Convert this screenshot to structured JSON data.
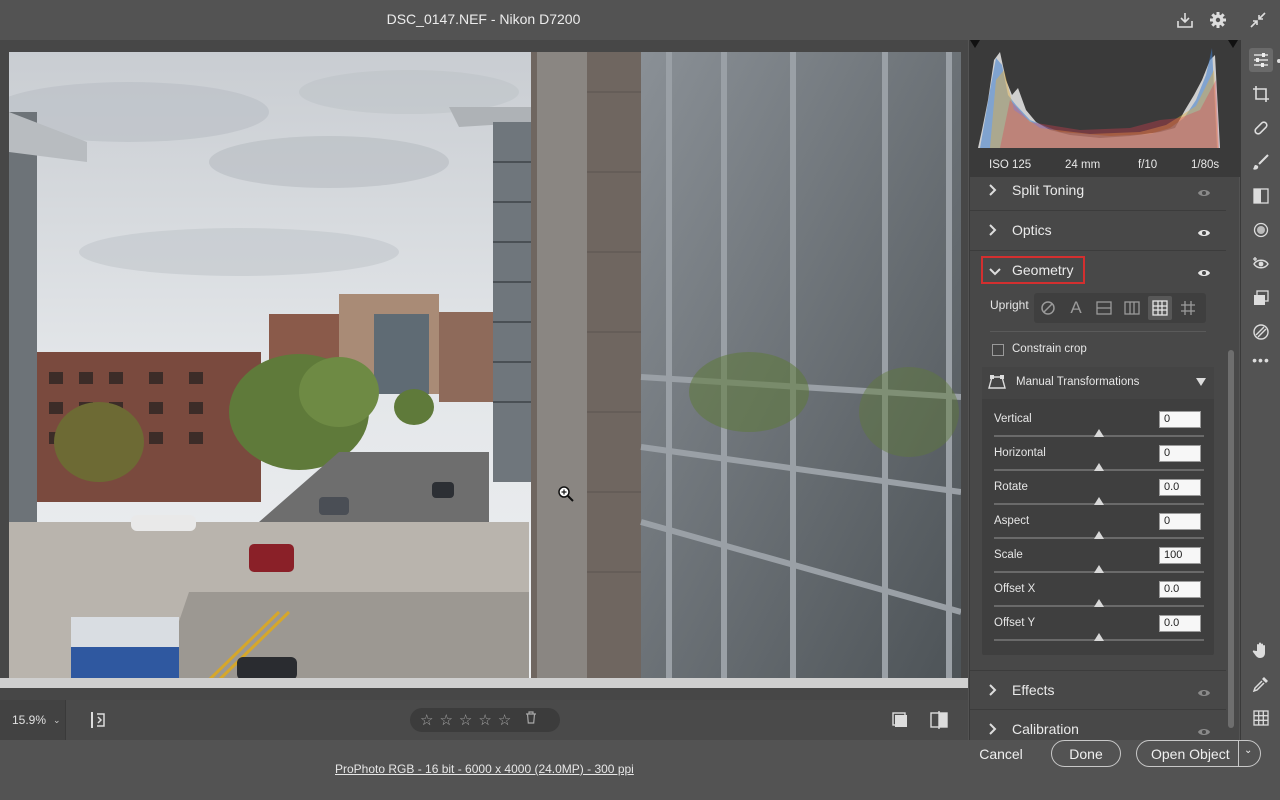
{
  "window": {
    "title": "DSC_0147.NEF  -  Nikon D7200"
  },
  "titlebar_icons": [
    "save-icon",
    "gear-icon",
    "collapse-icon"
  ],
  "canvas": {
    "zoom_label": "15.9%",
    "rating_stars": 5,
    "trash_icon": "trash-icon"
  },
  "exif": {
    "iso": "ISO 125",
    "focal": "24 mm",
    "aperture": "f/10",
    "shutter": "1/80s"
  },
  "panel": {
    "sections": {
      "split_toning": "Split Toning",
      "optics": "Optics",
      "geometry": "Geometry",
      "effects": "Effects",
      "calibration": "Calibration"
    },
    "upright_label": "Upright",
    "constrain_crop": "Constrain crop",
    "manual_title": "Manual Transformations",
    "sliders": [
      {
        "label": "Vertical",
        "value": "0",
        "position": 0.5
      },
      {
        "label": "Horizontal",
        "value": "0",
        "position": 0.5
      },
      {
        "label": "Rotate",
        "value": "0.0",
        "position": 0.5
      },
      {
        "label": "Aspect",
        "value": "0",
        "position": 0.5
      },
      {
        "label": "Scale",
        "value": "100",
        "position": 0.5
      },
      {
        "label": "Offset X",
        "value": "0.0",
        "position": 0.5
      },
      {
        "label": "Offset Y",
        "value": "0.0",
        "position": 0.5
      }
    ]
  },
  "status": {
    "doc_info": "ProPhoto RGB - 16 bit - 6000 x 4000 (24.0MP) - 300 ppi",
    "cancel": "Cancel",
    "done": "Done",
    "open_object": "Open Object"
  },
  "colors": {
    "accent_highlight": "#d32f2f",
    "panel_bg": "#484848",
    "window_bg": "#535353"
  },
  "tools": [
    "edit-sliders-icon",
    "crop-icon",
    "spot-removal-icon",
    "adjustment-brush-icon",
    "graduated-filter-icon",
    "radial-filter-icon",
    "red-eye-icon",
    "snapshots-icon",
    "presets-icon",
    "more-icon",
    "hand-icon",
    "color-sampler-icon",
    "grid-icon"
  ]
}
